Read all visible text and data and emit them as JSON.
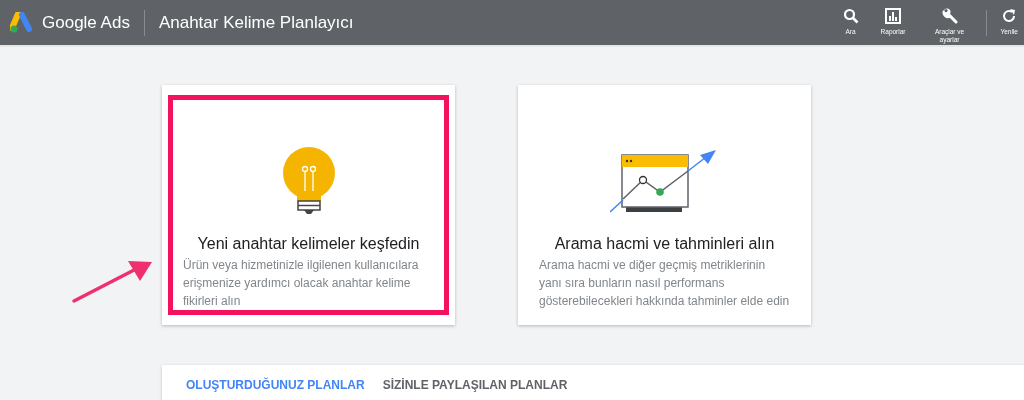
{
  "header": {
    "brand": "Google Ads",
    "title": "Anahtar Kelime Planlayıcı",
    "actions": [
      {
        "kind": "search",
        "label": "Ara"
      },
      {
        "kind": "reports",
        "label": "Raporlar"
      },
      {
        "kind": "tools",
        "label": "Araçlar ve ayarlar"
      },
      {
        "kind": "refresh",
        "label": "Yenile"
      }
    ]
  },
  "cards": [
    {
      "kind": "bulb",
      "title": "Yeni anahtar kelimeler keşfedin",
      "description": "Ürün veya hizmetinizle ilgilenen kullanıcılara erişmenize yardımcı olacak anahtar kelime fikirleri alın",
      "highlighted": true
    },
    {
      "kind": "chart",
      "title": "Arama hacmi ve tahminleri alın",
      "description": "Arama hacmi ve diğer geçmiş metriklerinin yanı sıra bunların nasıl performans gösterebilecekleri hakkında tahminler elde edin",
      "highlighted": false
    }
  ],
  "tabs": [
    {
      "label": "OLUŞTURDUĞUNUZ PLANLAR",
      "selected": true
    },
    {
      "label": "SİZİNLE PAYLAŞILAN PLANLAR",
      "selected": false
    }
  ]
}
